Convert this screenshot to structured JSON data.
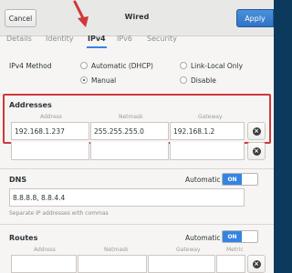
{
  "header": {
    "cancel_label": "Cancel",
    "title": "Wired",
    "apply_label": "Apply"
  },
  "tabs": [
    "Details",
    "Identity",
    "IPv4",
    "IPv6",
    "Security"
  ],
  "active_tab": "IPv4",
  "ipv4_method": {
    "label": "IPv4 Method",
    "options": [
      "Automatic (DHCP)",
      "Link-Local Only",
      "Manual",
      "Disable"
    ],
    "selected": "Manual"
  },
  "addresses": {
    "title": "Addresses",
    "columns": [
      "Address",
      "Netmask",
      "Gateway"
    ],
    "rows": [
      {
        "address": "192.168.1.237",
        "netmask": "255.255.255.0",
        "gateway": "192.168.1.2"
      }
    ]
  },
  "dns": {
    "title": "DNS",
    "automatic_label": "Automatic",
    "switch_label": "ON",
    "value": "8.8.8.8, 8.8.4.4",
    "hint": "Separate IP addresses with commas"
  },
  "routes": {
    "title": "Routes",
    "automatic_label": "Automatic",
    "switch_label": "ON",
    "columns": [
      "Address",
      "Netmask",
      "Gateway",
      "Metric"
    ]
  },
  "colors": {
    "accent": "#3584e4",
    "highlight_box": "#d0383a",
    "arrow": "#d0383a"
  }
}
